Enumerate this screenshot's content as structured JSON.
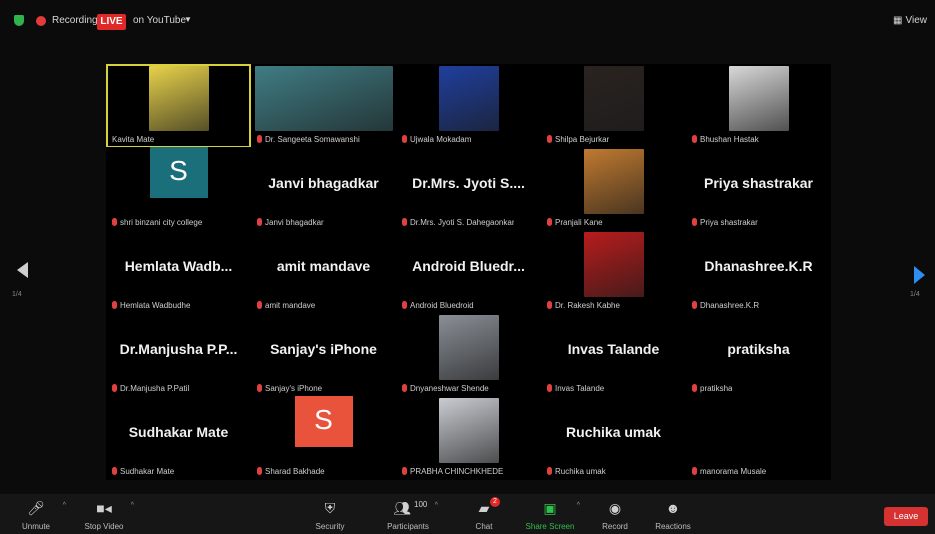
{
  "topbar": {
    "recording_label": "Recording",
    "live_label": "LIVE",
    "stream_label": "on YouTube",
    "view_label": "View"
  },
  "participants": [
    {
      "name": "Kavita Mate",
      "display": "",
      "kind": "video",
      "active": true,
      "color": "#e8d24a"
    },
    {
      "name": "Dr. Sangeeta Somawanshi",
      "display": "",
      "kind": "video",
      "color": "#3f7d84"
    },
    {
      "name": "Ujwala Mokadam",
      "display": "",
      "kind": "video",
      "color": "#1f3f9e"
    },
    {
      "name": "Shilpa Bejurkar",
      "display": "",
      "kind": "video",
      "color": "#2a2320"
    },
    {
      "name": "Bhushan Hastak",
      "display": "",
      "kind": "video",
      "color": "#d8d8d8"
    },
    {
      "name": "shri binzani city college",
      "display": "",
      "kind": "avatar",
      "letter": "S",
      "color": "#1b6f7a"
    },
    {
      "name": "Janvi bhagadkar",
      "display": "Janvi bhagadkar",
      "kind": "text"
    },
    {
      "name": "Dr.Mrs. Jyoti S. Dahegaonkar",
      "display": "Dr.Mrs. Jyoti S....",
      "kind": "text"
    },
    {
      "name": "Pranjali Kane",
      "display": "",
      "kind": "video",
      "color": "#c07a30"
    },
    {
      "name": "Priya shastrakar",
      "display": "Priya shastrakar",
      "kind": "text"
    },
    {
      "name": "Hemlata Wadbudhe",
      "display": "Hemlata Wadb...",
      "kind": "text"
    },
    {
      "name": "amit mandave",
      "display": "amit mandave",
      "kind": "text"
    },
    {
      "name": "Android Bluedroid",
      "display": "Android Bluedr...",
      "kind": "text"
    },
    {
      "name": "Dr. Rakesh Kabhe",
      "display": "",
      "kind": "video",
      "color": "#b81c1c"
    },
    {
      "name": "Dhanashree.K.R",
      "display": "Dhanashree.K.R",
      "kind": "text"
    },
    {
      "name": "Dr.Manjusha P.Patil",
      "display": "Dr.Manjusha P.P...",
      "kind": "text"
    },
    {
      "name": "Sanjay's iPhone",
      "display": "Sanjay's iPhone",
      "kind": "text"
    },
    {
      "name": "Dnyaneshwar Shende",
      "display": "",
      "kind": "video",
      "color": "#8a8f96"
    },
    {
      "name": "Invas Talande",
      "display": "Invas Talande",
      "kind": "text"
    },
    {
      "name": "pratiksha",
      "display": "pratiksha",
      "kind": "text"
    },
    {
      "name": "Sudhakar Mate",
      "display": "Sudhakar Mate",
      "kind": "text"
    },
    {
      "name": "Sharad Bakhade",
      "display": "",
      "kind": "avatar",
      "letter": "S",
      "color": "#e9523b"
    },
    {
      "name": "PRABHA CHINCHKHEDE",
      "display": "",
      "kind": "video",
      "color": "#c9ccd2"
    },
    {
      "name": "Ruchika umak",
      "display": "Ruchika umak",
      "kind": "text"
    },
    {
      "name": "manorama Musale",
      "display": "",
      "kind": "text"
    }
  ],
  "toolbar": {
    "unmute": "Unmute",
    "stop_video": "Stop Video",
    "security": "Security",
    "participants": "Participants",
    "participants_count": "100",
    "chat": "Chat",
    "chat_badge": "2",
    "share_screen": "Share Screen",
    "record": "Record",
    "reactions": "Reactions",
    "leave": "Leave"
  },
  "colors": {
    "accent_blue": "#2e8ef0",
    "live_red": "#e02828",
    "active_speaker": "#d8d23a",
    "share_green": "#2fbf4a"
  }
}
